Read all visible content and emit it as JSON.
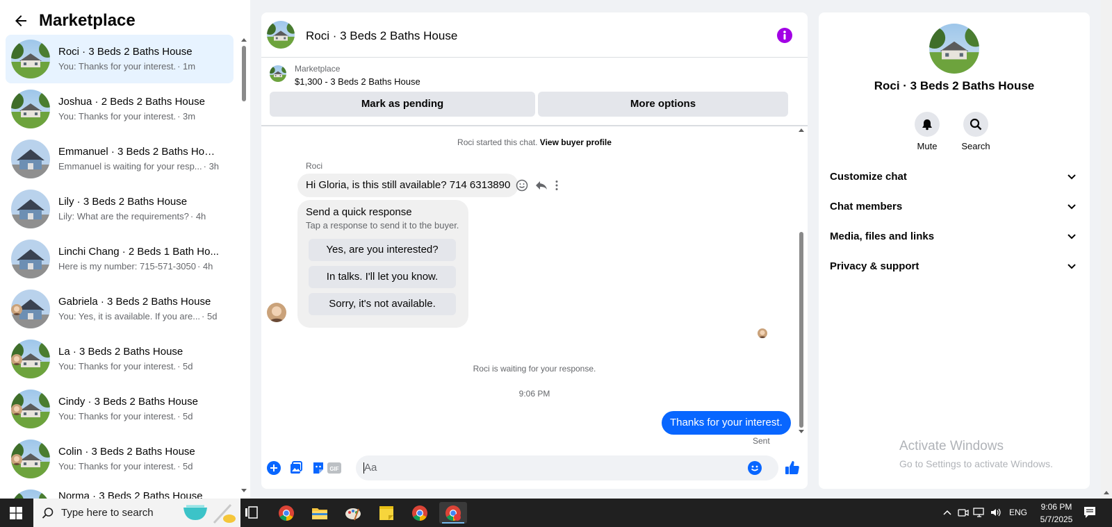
{
  "marketplace": {
    "title": "Marketplace"
  },
  "conversations": [
    {
      "name": "Roci · 3 Beds 2 Baths House",
      "preview": "You: Thanks for your interest.",
      "time": "· 1m"
    },
    {
      "name": "Joshua · 2 Beds 2 Baths House",
      "preview": "You: Thanks for your interest.",
      "time": "· 3m"
    },
    {
      "name": "Emmanuel · 3 Beds 2 Baths House",
      "preview": "Emmanuel is waiting for your resp...",
      "time": "· 3h"
    },
    {
      "name": "Lily · 3 Beds 2 Baths House",
      "preview": "Lily: What are the requirements?",
      "time": "· 4h"
    },
    {
      "name": "Linchi Chang · 2 Beds 1 Bath Ho...",
      "preview": "Here is my number: 715-571-3050",
      "time": "· 4h"
    },
    {
      "name": "Gabriela · 3 Beds 2 Baths House",
      "preview": "You: Yes, it is available. If you are...",
      "time": "· 5d"
    },
    {
      "name": "La · 3 Beds 2 Baths House",
      "preview": "You: Thanks for your interest.",
      "time": "· 5d"
    },
    {
      "name": "Cindy · 3 Beds 2 Baths House",
      "preview": "You: Thanks for your interest.",
      "time": "· 5d"
    },
    {
      "name": "Colin · 3 Beds 2 Baths House",
      "preview": "You: Thanks for your interest.",
      "time": "· 5d"
    },
    {
      "name": "Norma · 3 Beds 2 Baths House",
      "preview": "",
      "time": ""
    }
  ],
  "chat": {
    "title": "Roci · 3 Beds 2 Baths House",
    "listing_label": "Marketplace",
    "listing_price": "$1,300 - 3 Beds 2 Baths House",
    "mark_pending": "Mark as pending",
    "more_options": "More options",
    "started_text": "Roci started this chat.",
    "view_profile": "View buyer profile",
    "sender": "Roci",
    "incoming": "Hi Gloria, is this still available? 714 6313890",
    "quick_title": "Send a quick response",
    "quick_subtitle": "Tap a response to send it to the buyer.",
    "quick_replies": [
      "Yes, are you interested?",
      "In talks. I'll let you know.",
      "Sorry, it's not available."
    ],
    "waiting": "Roci is waiting for your response.",
    "timestamp": "9:06 PM",
    "outgoing": "Thanks for your interest.",
    "status": "Sent",
    "composer_placeholder": "Aa"
  },
  "details": {
    "name": "Roci · 3 Beds 2 Baths House",
    "mute": "Mute",
    "search": "Search",
    "sections": [
      "Customize chat",
      "Chat members",
      "Media, files and links",
      "Privacy & support"
    ]
  },
  "watermark": {
    "line1": "Activate Windows",
    "line2": "Go to Settings to activate Windows."
  },
  "taskbar": {
    "search_placeholder": "Type here to search",
    "lang": "ENG",
    "time": "9:06 PM",
    "date": "5/7/2025"
  },
  "colors": {
    "accent": "#0866ff",
    "purple": "#a200e5"
  }
}
